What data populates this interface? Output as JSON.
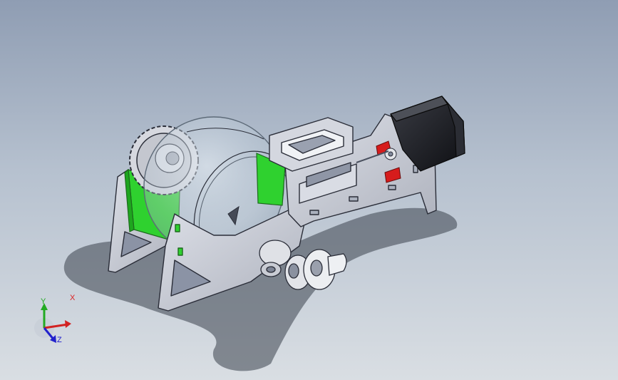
{
  "view": {
    "background_top": "#8f9db3",
    "background_bottom": "#d9dee3",
    "part_color": "#c9ccd6",
    "edge_color": "#2a2d38",
    "highlight_color": "#2fd12f",
    "accent_color": "#d61c1c",
    "motor_color": "#1e1f24"
  },
  "triad": {
    "x_label": "X",
    "y_label": "Y",
    "z_label": "Z",
    "x_color": "#d22222",
    "y_color": "#22aa22",
    "z_color": "#2222cc"
  }
}
